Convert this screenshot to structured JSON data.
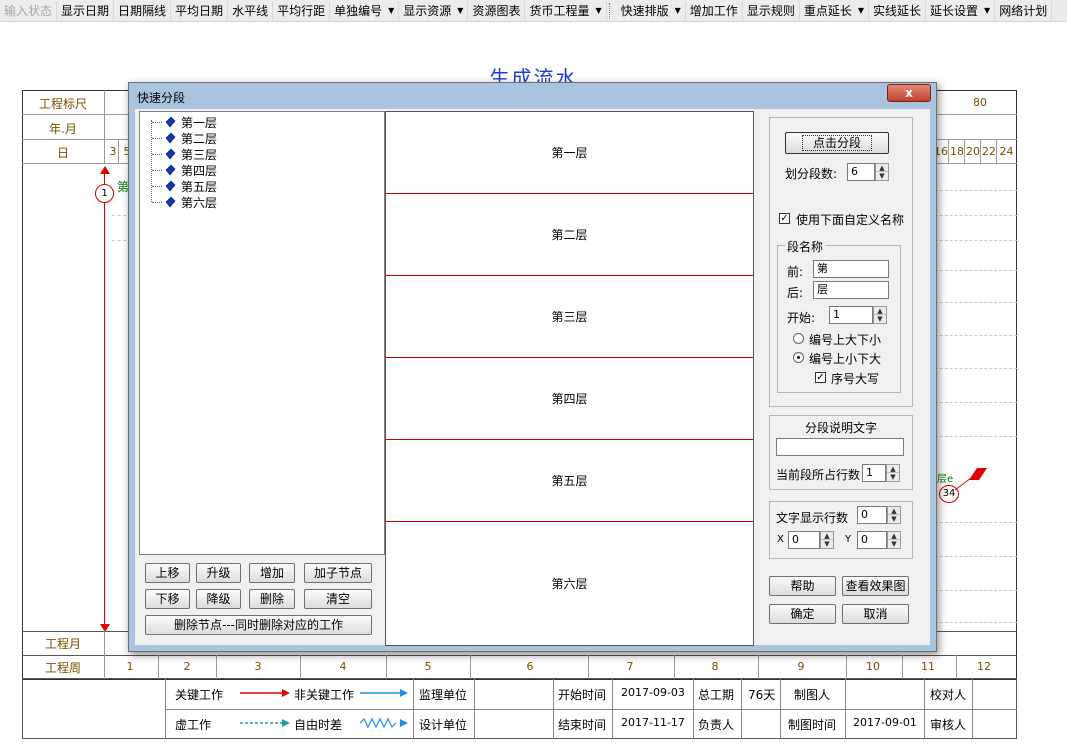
{
  "toolbar": {
    "items": [
      {
        "label": "输入状态",
        "disabled": true
      },
      {
        "label": "显示日期"
      },
      {
        "label": "日期隔线"
      },
      {
        "label": "平均日期"
      },
      {
        "label": "水平线"
      },
      {
        "label": "平均行距"
      },
      {
        "label": "单独编号",
        "dropdown": true
      },
      {
        "label": "显示资源",
        "dropdown": true
      },
      {
        "label": "资源图表"
      },
      {
        "label": "货币工程量",
        "dropdown": true
      },
      {
        "label": "快速排版",
        "dropdown": true
      },
      {
        "label": "增加工作"
      },
      {
        "label": "显示规则"
      },
      {
        "label": "重点延长",
        "dropdown": true
      },
      {
        "label": "实线延长"
      },
      {
        "label": "延长设置",
        "dropdown": true
      },
      {
        "label": "网络计划"
      }
    ]
  },
  "chart": {
    "title": "生成流水",
    "row_labels": {
      "ruler": "工程标尺",
      "year_month": "年.月",
      "day": "日",
      "project_month": "工程月",
      "project_week": "工程周"
    },
    "ruler_right": "80",
    "days_left": [
      "3",
      "5"
    ],
    "days_right": [
      "16",
      "18",
      "20",
      "22",
      "24"
    ],
    "weeks": [
      "1",
      "2",
      "3",
      "4",
      "5",
      "6",
      "7",
      "8",
      "9",
      "10",
      "11",
      "12"
    ],
    "node_start": "1",
    "node_end": "34",
    "partial_label_left": "第",
    "partial_label_right": "层e"
  },
  "legend": {
    "critical": "关键工作",
    "noncritical": "非关键工作",
    "virtual": "虚工作",
    "free_float": "自由时差",
    "supervisor": "监理单位",
    "designer": "设计单位",
    "start_time_label": "开始时间",
    "start_time": "2017-09-03",
    "end_time_label": "结束时间",
    "end_time": "2017-11-17",
    "total_label": "总工期",
    "total": "76天",
    "owner_label": "负责人",
    "drawer_label": "制图人",
    "draw_time_label": "制图时间",
    "draw_time": "2017-09-01",
    "checker_label": "校对人",
    "reviewer_label": "审核人",
    "colors": {
      "critical": "#e00000",
      "noncritical": "#1e8fe6",
      "virtual": "#1aa0a0"
    }
  },
  "dialog": {
    "title": "快速分段",
    "close_label": "x",
    "tree_items": [
      "第一层",
      "第二层",
      "第三层",
      "第四层",
      "第五层",
      "第六层"
    ],
    "tree_buttons": {
      "move_up": "上移",
      "promote": "升级",
      "add": "增加",
      "add_child": "加子节点",
      "move_down": "下移",
      "demote": "降级",
      "delete": "删除",
      "clear": "清空",
      "delete_node": "删除节点---同时删除对应的工作"
    },
    "segments": [
      "第一层",
      "第二层",
      "第三层",
      "第四层",
      "第五层",
      "第六层"
    ],
    "split_button": "点击分段",
    "segment_count_label": "划分段数:",
    "segment_count": "6",
    "use_custom_name_label": "使用下面自定义名称",
    "use_custom_name": true,
    "name_group": "段名称",
    "prefix_label": "前:",
    "prefix": "第",
    "suffix_label": "后:",
    "suffix": "层",
    "start_label": "开始:",
    "start": "1",
    "radio_big_top": "编号上大下小",
    "radio_small_top": "编号上小下大",
    "radio_selected": "small_top",
    "uppercase_label": "序号大写",
    "uppercase": true,
    "desc_group": "分段说明文字",
    "desc_value": "",
    "lines_label": "当前段所占行数",
    "lines": "1",
    "text_lines_label": "文字显示行数",
    "text_lines": "0",
    "x_label": "X",
    "x_value": "0",
    "y_label": "Y",
    "y_value": "0",
    "help_button": "帮助",
    "preview_button": "查看效果图",
    "ok_button": "确定",
    "cancel_button": "取消"
  }
}
